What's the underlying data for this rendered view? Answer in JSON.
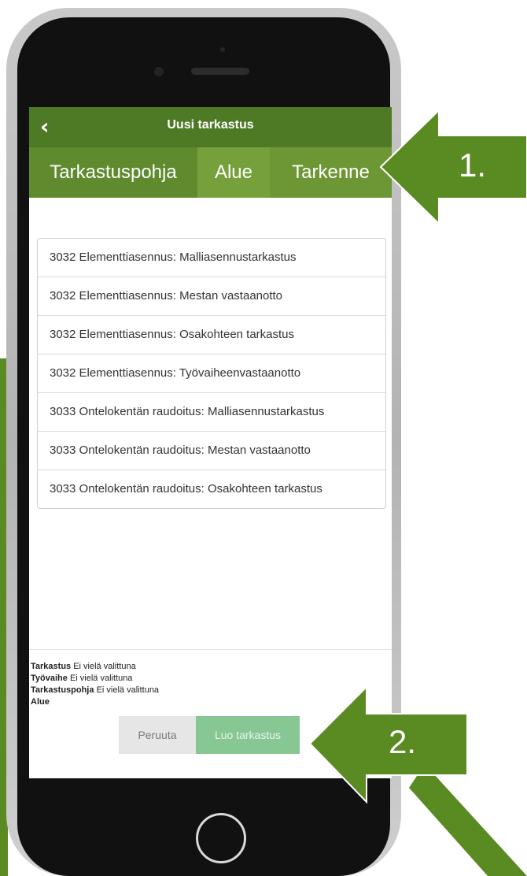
{
  "colors": {
    "green_dark": "#4e7a26",
    "green_mid": "#6d9634",
    "green_arrow": "#5a8a22",
    "button_green": "#86c794"
  },
  "topbar": {
    "back_icon": "chevron-left",
    "title": "Uusi tarkastus"
  },
  "tabs": [
    {
      "label": "Tarkastuspohja"
    },
    {
      "label": "Alue"
    },
    {
      "label": "Tarkenne"
    }
  ],
  "list": [
    "3032 Elementtiasennus: Malliasennustarkastus",
    "3032 Elementtiasennus: Mestan vastaanotto",
    "3032 Elementtiasennus: Osakohteen tarkastus",
    "3032 Elementtiasennus: Työvaiheenvastaanotto",
    "3033 Ontelokentän raudoitus: Malliasennustarkastus",
    "3033 Ontelokentän raudoitus: Mestan vastaanotto",
    "3033 Ontelokentän raudoitus: Osakohteen tarkastus"
  ],
  "summary": {
    "tarkastus_label": "Tarkastus",
    "tarkastus_value": "Ei vielä valittuna",
    "tyovaihe_label": "Työvaihe",
    "tyovaihe_value": "Ei vielä valittuna",
    "pohja_label": "Tarkastuspohja",
    "pohja_value": "Ei vielä valittuna",
    "alue_label": "Alue"
  },
  "buttons": {
    "cancel": "Peruuta",
    "create": "Luo tarkastus"
  },
  "annotations": {
    "one": "1.",
    "two": "2."
  }
}
